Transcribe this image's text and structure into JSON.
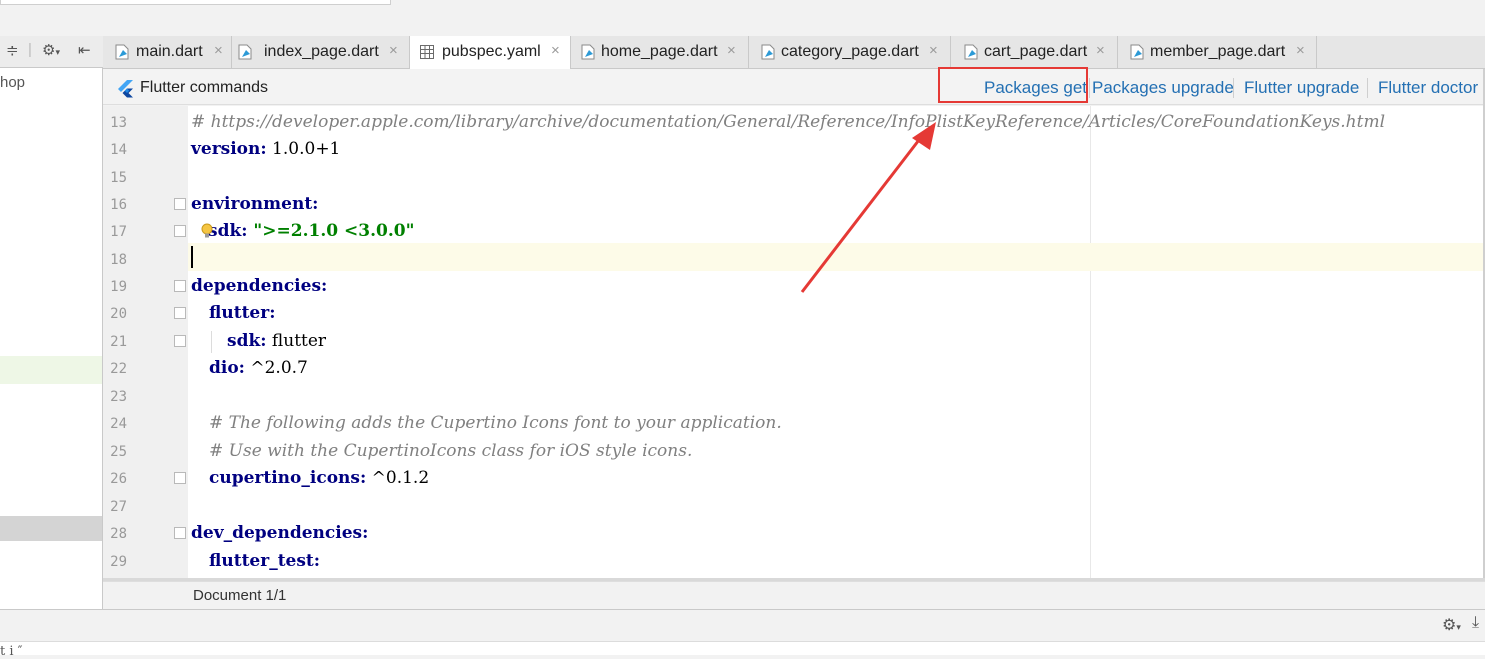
{
  "left_panel": {
    "project_label_fragment": "hop",
    "toolbar_icons": [
      "collapse-icon",
      "gear-icon",
      "hide-icon"
    ]
  },
  "tabs": [
    {
      "label": "main.dart",
      "active": false,
      "icon": "dart-file-icon"
    },
    {
      "label": "index_page.dart",
      "active": false,
      "icon": "dart-file-icon"
    },
    {
      "label": "pubspec.yaml",
      "active": true,
      "icon": "yaml-table-icon"
    },
    {
      "label": "home_page.dart",
      "active": false,
      "icon": "dart-file-icon"
    },
    {
      "label": "category_page.dart",
      "active": false,
      "icon": "dart-file-icon"
    },
    {
      "label": "cart_page.dart",
      "active": false,
      "icon": "dart-file-icon"
    },
    {
      "label": "member_page.dart",
      "active": false,
      "icon": "dart-file-icon"
    }
  ],
  "close_glyph": "×",
  "commands_bar": {
    "title": "Flutter commands",
    "links": [
      "Packages get",
      "Packages upgrade",
      "Flutter upgrade",
      "Flutter doctor"
    ],
    "highlighted": "Packages get"
  },
  "editor": {
    "lines": [
      {
        "n": "13",
        "text": "# https://developer.apple.com/library/archive/documentation/General/Reference/InfoPlistKeyReference/Articles/CoreFoundationKeys.html"
      },
      {
        "n": "14",
        "key": "version:",
        "value": " 1.0.0+1"
      },
      {
        "n": "15"
      },
      {
        "n": "16",
        "key": "environment:"
      },
      {
        "n": "17",
        "key": "sdk:",
        "str": " \">=2.1.0 <3.0.0\""
      },
      {
        "n": "18"
      },
      {
        "n": "19",
        "key": "dependencies:"
      },
      {
        "n": "20",
        "key": "flutter:"
      },
      {
        "n": "21",
        "key": "sdk:",
        "value": " flutter"
      },
      {
        "n": "22",
        "key": "dio:",
        "value": " ^2.0.7"
      },
      {
        "n": "23"
      },
      {
        "n": "24",
        "text": "# The following adds the Cupertino Icons font to your application."
      },
      {
        "n": "25",
        "text": "# Use with the CupertinoIcons class for iOS style icons."
      },
      {
        "n": "26",
        "key": "cupertino_icons:",
        "value": " ^0.1.2"
      },
      {
        "n": "27"
      },
      {
        "n": "28",
        "key": "dev_dependencies:"
      },
      {
        "n": "29",
        "key": "flutter_test:"
      }
    ]
  },
  "status_bar": {
    "text": "Document 1/1"
  },
  "bottom_panel": {
    "text_fragment": "t  i  ″"
  },
  "colors": {
    "link": "#2470b3",
    "highlight_box": "#e53935",
    "arrow": "#e53935",
    "current_line": "#fdfbe8"
  }
}
